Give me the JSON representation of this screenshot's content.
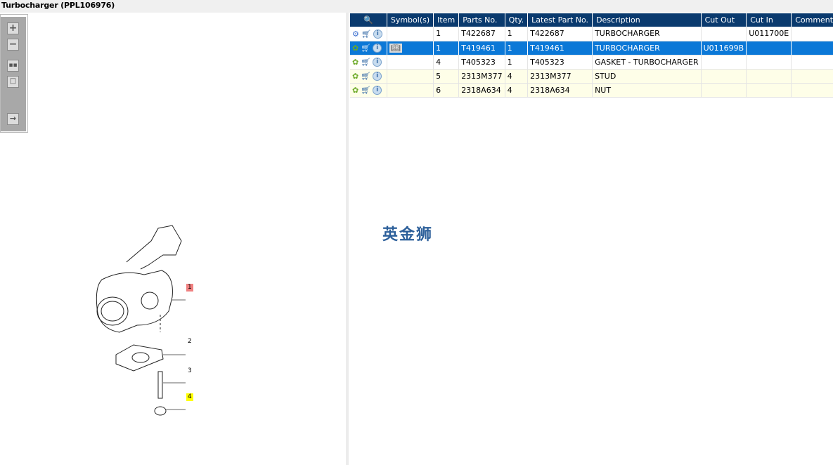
{
  "window": {
    "title": "Turbocharger (PPL106976)"
  },
  "toolbar": {
    "zoom_in": "zoom-in",
    "zoom_out": "zoom-out",
    "fit_all": "fit-all",
    "fit_window": "fit-window",
    "toggle_panel": "toggle-panel"
  },
  "drawing": {
    "callouts": [
      "1",
      "2",
      "3",
      "4"
    ],
    "highlight_colors": {
      "1": "#f08080",
      "4": "#ffff00"
    }
  },
  "table": {
    "headers": [
      "Symbol(s)",
      "Item",
      "Parts No.",
      "Qty.",
      "Latest Part No.",
      "Description",
      "Cut Out",
      "Cut In",
      "Comment"
    ],
    "rows": [
      {
        "item": "1",
        "part": "T422687",
        "qty": "1",
        "latest": "T422687",
        "desc": "TURBOCHARGER",
        "cut_out": "",
        "cut_in": "U011700E",
        "comment": ""
      },
      {
        "item": "1",
        "part": "T419461",
        "qty": "1",
        "latest": "T419461",
        "desc": "TURBOCHARGER",
        "cut_out": "U011699B",
        "cut_in": "",
        "comment": ""
      },
      {
        "item": "4",
        "part": "T405323",
        "qty": "1",
        "latest": "T405323",
        "desc": "GASKET - TURBOCHARGER",
        "cut_out": "",
        "cut_in": "",
        "comment": ""
      },
      {
        "item": "5",
        "part": "2313M377",
        "qty": "4",
        "latest": "2313M377",
        "desc": "STUD",
        "cut_out": "",
        "cut_in": "",
        "comment": ""
      },
      {
        "item": "6",
        "part": "2318A634",
        "qty": "4",
        "latest": "2318A634",
        "desc": "NUT",
        "cut_out": "",
        "cut_in": "",
        "comment": ""
      }
    ],
    "selected_row": 1
  },
  "watermark": "英金狮",
  "colors": {
    "header": "#0a3a6e",
    "selected": "#0b78d7",
    "yellow_row": "#fefee8"
  }
}
